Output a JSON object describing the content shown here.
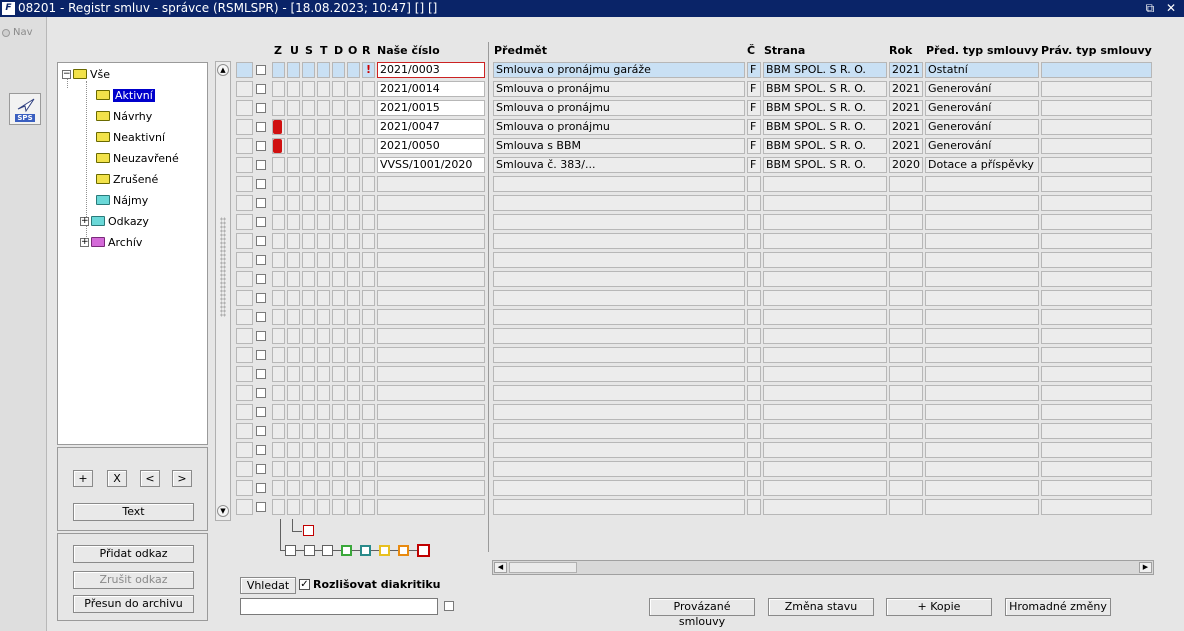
{
  "title": "08201 - Registr smluv - správce (RSMLSPR) - [18.08.2023; 10:47] [] []",
  "window_controls": "⧉ ✕",
  "nav_label": "Nav",
  "sps_label": "SPS",
  "tree": {
    "root": "Vše",
    "items": [
      "Aktivní",
      "Návrhy",
      "Neaktivní",
      "Neuzavřené",
      "Zrušené",
      "Nájmy",
      "Odkazy",
      "Archív"
    ]
  },
  "tree_buttons": {
    "plus": "+",
    "x": "X",
    "prev": "<",
    "next": ">",
    "text": "Text"
  },
  "actions": {
    "add_link": "Přidat odkaz",
    "cancel_link": "Zrušit odkaz",
    "move_archive": "Přesun do archivu"
  },
  "search": {
    "button": "Vhledat",
    "diacritics_label": "Rozlišovat diakritiku",
    "diacritics_checked": true,
    "value": ""
  },
  "columns": {
    "z": "Z",
    "u": "U",
    "s": "S",
    "t": "T",
    "d": "D",
    "o": "O",
    "r": "R",
    "nase_cislo": "Naše číslo",
    "predmet": "Předmět",
    "c": "Č",
    "strana": "Strana",
    "rok": "Rok",
    "pred_typ": "Před. typ smlouvy",
    "prav_typ": "Práv. typ smlouvy"
  },
  "rows": [
    {
      "nase_cislo": "2021/0003",
      "predmet": "Smlouva o pronájmu garáže",
      "c": "F",
      "strana": "BBM SPOL. S R. O.",
      "rok": "2021",
      "pred_typ": "Ostatní",
      "prav_typ": "",
      "flag": false,
      "excl": "!"
    },
    {
      "nase_cislo": "2021/0014",
      "predmet": "Smlouva o pronájmu",
      "c": "F",
      "strana": "BBM SPOL. S R. O.",
      "rok": "2021",
      "pred_typ": "Generování",
      "prav_typ": "",
      "flag": false,
      "excl": ""
    },
    {
      "nase_cislo": "2021/0015",
      "predmet": "Smlouva o pronájmu",
      "c": "F",
      "strana": "BBM SPOL. S R. O.",
      "rok": "2021",
      "pred_typ": "Generování",
      "prav_typ": "",
      "flag": false,
      "excl": ""
    },
    {
      "nase_cislo": "2021/0047",
      "predmet": "Smlouva o pronájmu",
      "c": "F",
      "strana": "BBM SPOL. S R. O.",
      "rok": "2021",
      "pred_typ": "Generování",
      "prav_typ": "",
      "flag": true,
      "excl": ""
    },
    {
      "nase_cislo": "2021/0050",
      "predmet": "Smlouva s BBM",
      "c": "F",
      "strana": "BBM SPOL. S R. O.",
      "rok": "2021",
      "pred_typ": "Generování",
      "prav_typ": "",
      "flag": true,
      "excl": ""
    },
    {
      "nase_cislo": "VVSS/1001/2020",
      "predmet": "Smlouva č. 383/...",
      "c": "F",
      "strana": "BBM SPOL. S R. O.",
      "rok": "2020",
      "pred_typ": "Dotace a příspěvky",
      "prav_typ": "",
      "flag": false,
      "excl": ""
    }
  ],
  "bottom_buttons": {
    "linked": "Provázané smlouvy",
    "state": "Změna stavu",
    "copy": "+ Kopie",
    "bulk": "Hromadné změny"
  },
  "colors": {
    "title_bg": "#0a2468",
    "selected_tree": "#0000cc",
    "row_highlight": "#c9e0f4",
    "flag_red": "#d01010"
  }
}
